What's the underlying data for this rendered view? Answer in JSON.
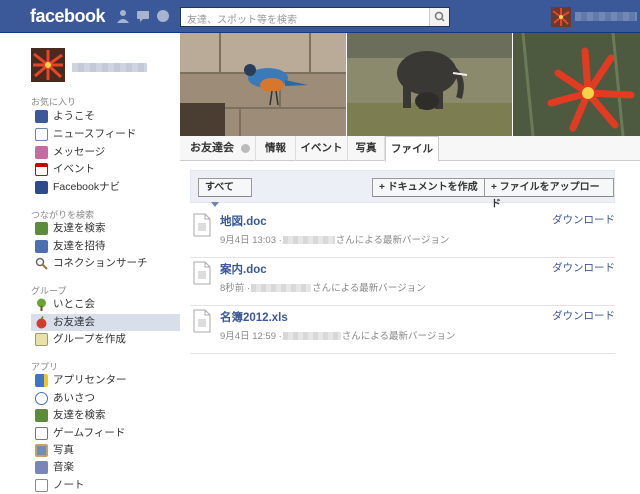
{
  "header": {
    "logo": "facebook",
    "search_placeholder": "友達、スポット等を検索"
  },
  "sidebar": {
    "favorites_title": "お気に入り",
    "favorites": [
      {
        "label": "ようこそ",
        "icon": "fb-icon"
      },
      {
        "label": "ニュースフィード",
        "icon": "newsfeed-icon"
      },
      {
        "label": "メッセージ",
        "icon": "message-icon"
      },
      {
        "label": "イベント",
        "icon": "event-icon"
      },
      {
        "label": "Facebookナビ",
        "icon": "navi-icon"
      }
    ],
    "connect_title": "つながりを検索",
    "connect": [
      {
        "label": "友達を検索",
        "icon": "find-friends-icon"
      },
      {
        "label": "友達を招待",
        "icon": "invite-icon"
      },
      {
        "label": "コネクションサーチ",
        "icon": "magnifier-icon"
      }
    ],
    "groups_title": "グループ",
    "groups": [
      {
        "label": "いとこ会",
        "icon": "tree-icon"
      },
      {
        "label": "お友達会",
        "icon": "apple-icon",
        "active": true
      },
      {
        "label": "グループを作成",
        "icon": "create-group-icon"
      }
    ],
    "apps_title": "アプリ",
    "apps": [
      {
        "label": "アプリセンター",
        "icon": "app-center-icon"
      },
      {
        "label": "あいさつ",
        "icon": "poke-icon"
      },
      {
        "label": "友達を検索",
        "icon": "find-friends-icon"
      },
      {
        "label": "ゲームフィード",
        "icon": "game-icon"
      },
      {
        "label": "写真",
        "icon": "photo-icon"
      },
      {
        "label": "音楽",
        "icon": "music-icon"
      },
      {
        "label": "ノート",
        "icon": "note-icon"
      }
    ]
  },
  "tabs": {
    "group_name": "お友達会",
    "items": [
      "情報",
      "イベント",
      "写真",
      "ファイル"
    ],
    "active": "ファイル"
  },
  "toolbar": {
    "filter": "すべて",
    "create_doc": "+ ドキュメントを作成",
    "upload": "+ ファイルをアップロード"
  },
  "files": [
    {
      "name": "地図.doc",
      "date": "9月4日 13:03 ·",
      "suffix": "さんによる最新バージョン",
      "download": "ダウンロード"
    },
    {
      "name": "案内.doc",
      "date": "8秒前 ·",
      "suffix": "さんによる最新バージョン",
      "download": "ダウンロード"
    },
    {
      "name": "名簿2012.xls",
      "date": "9月4日 12:59 ·",
      "suffix": "さんによる最新バージョン",
      "download": "ダウンロード"
    }
  ],
  "colors": {
    "brand": "#3b5998",
    "active_item": "#d8dfea"
  }
}
